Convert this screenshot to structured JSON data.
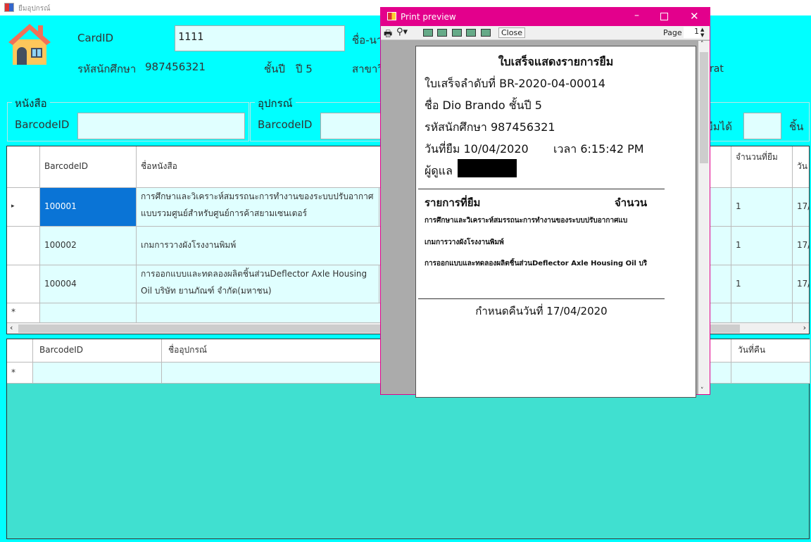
{
  "window": {
    "title": "ยืมอุปกรณ์"
  },
  "header": {
    "card_label": "CardID",
    "card_value": "1111",
    "name_label": "ชื่อ-นา",
    "student_id_label": "รหัสนักศึกษา",
    "student_id": "987456321",
    "year_label": "ชั้นปี",
    "year_value": "ปี 5",
    "major_label": "สาขาวิ",
    "major_tail": "rat"
  },
  "book_group": {
    "title": "หนังสือ",
    "barcode_label": "BarcodeID",
    "barcode_value": ""
  },
  "equip_group": {
    "title": "อุปกรณ์",
    "barcode_label": "BarcodeID",
    "barcode_value": "",
    "can_borrow_label": "ยืมได้",
    "can_borrow_value": "",
    "unit": "ชิ้น"
  },
  "book_grid": {
    "columns": [
      "BarcodeID",
      "ชื่อหนังสือ",
      "จำนวนที่ยืม",
      "วัน"
    ],
    "rows": [
      {
        "barcode": "100001",
        "title": "การศึกษาและวิเคราะห์สมรรถนะการทำงานของระบบปรับอากาศแบบรวมศูนย์สำหรับศูนย์การค้าสยามเซนเตอร์",
        "qty": "1",
        "date": "17/"
      },
      {
        "barcode": "100002",
        "title": "เกมการวางผังโรงงานพิมพ์",
        "qty": "1",
        "date": "17/"
      },
      {
        "barcode": "100004",
        "title": "การออกแบบและทดลองผลิตชิ้นส่วนDeflector Axle Housing Oil บริษัท ยานภัณฑ์ จำกัด(มหาชน)",
        "qty": "1",
        "date": "17/"
      }
    ],
    "new_row_marker": "*",
    "current_row_marker": "▸"
  },
  "equip_grid": {
    "columns": [
      "BarcodeID",
      "ชื่ออุปกรณ์",
      "วันที่คืน"
    ],
    "new_row_marker": "*"
  },
  "print_preview": {
    "title": "Print preview",
    "close": "Close",
    "page_label": "Page",
    "page_value": "1",
    "receipt": {
      "heading": "ใบเสร็จแสดงรายการยืม",
      "number": "ใบเสร็จลำดับที่ BR-2020-04-00014",
      "name": "ชื่อ  Dio Brando    ชั้นปี 5",
      "student": "รหัสนักศึกษา 987456321",
      "date": "วันที่ยืม 10/04/2020",
      "time": "เวลา 6:15:42 PM",
      "staff": "ผู้ดูแล",
      "items_label": "รายการที่ยืม",
      "qty_label": "จำนวน",
      "items": [
        "การศึกษาและวิเคราะห์สมรรถนะการทำงานของระบบปรับอากาศแบ",
        "เกมการวางผังโรงงานพิมพ์",
        "การออกแบบและทดลองผลิตชิ้นส่วนDeflector Axle Housing Oil บริ"
      ],
      "due": "กำหนดคืนวันที่ 17/04/2020"
    }
  }
}
